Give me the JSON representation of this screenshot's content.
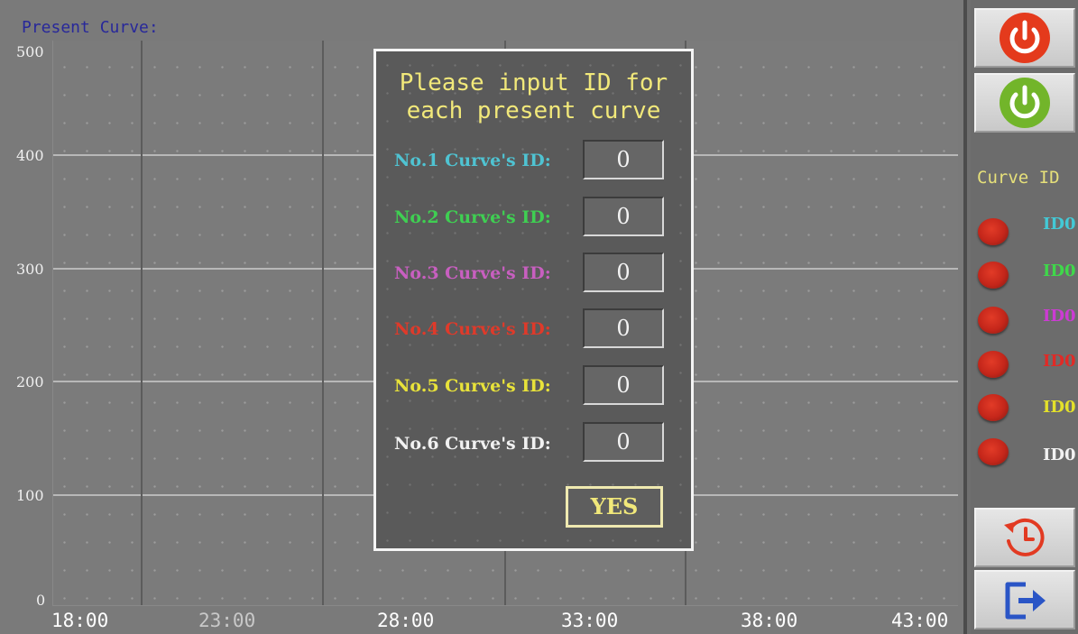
{
  "chart": {
    "title": "Present Curve:",
    "y_ticks": [
      "500",
      "400",
      "300",
      "200",
      "100",
      "0"
    ],
    "x_ticks": [
      {
        "label": "18:00",
        "color": "#ffffff"
      },
      {
        "label": "23:00",
        "color": "#c8c8c8"
      },
      {
        "label": "28:00",
        "color": "#ffffff"
      },
      {
        "label": "33:00",
        "color": "#ffffff"
      },
      {
        "label": "38:00",
        "color": "#ffffff"
      },
      {
        "label": "43:00",
        "color": "#ffffff"
      }
    ]
  },
  "sidebar": {
    "power_off_icon": "power-icon-red",
    "power_on_icon": "power-icon-green",
    "curve_id_title": "Curve ID",
    "ids": [
      {
        "label": "ID0",
        "color": "#43c9d6"
      },
      {
        "label": "ID0",
        "color": "#3fd84a"
      },
      {
        "label": "ID0",
        "color": "#cc3bd3"
      },
      {
        "label": "ID0",
        "color": "#e12a26"
      },
      {
        "label": "ID0",
        "color": "#e4e12a"
      },
      {
        "label": "ID0",
        "color": "#f2f2f2"
      }
    ],
    "history_icon": "clock-history-icon",
    "exit_icon": "exit-icon"
  },
  "dialog": {
    "title": "Please input ID for\neach present curve",
    "rows": [
      {
        "label": "No.1 Curve's ID:",
        "value": "0",
        "color": "#4fc3d2"
      },
      {
        "label": "No.2 Curve's ID:",
        "value": "0",
        "color": "#3fcf52"
      },
      {
        "label": "No.3 Curve's ID:",
        "value": "0",
        "color": "#c85fc0"
      },
      {
        "label": "No.4 Curve's ID:",
        "value": "0",
        "color": "#df3a2a"
      },
      {
        "label": "No.5 Curve's ID:",
        "value": "0",
        "color": "#e8e23a"
      },
      {
        "label": "No.6 Curve's ID:",
        "value": "0",
        "color": "#f1f1f1"
      }
    ],
    "yes_label": "YES"
  }
}
